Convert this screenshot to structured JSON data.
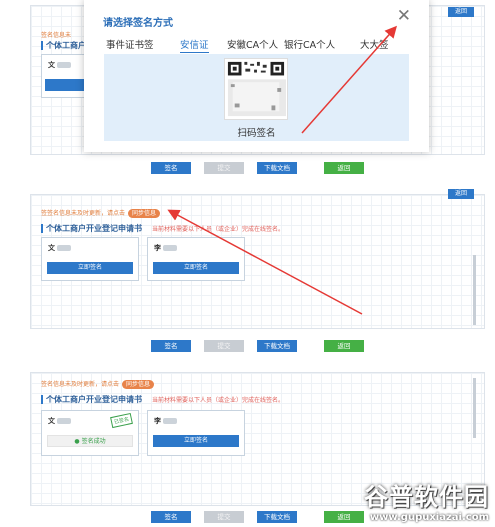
{
  "modal": {
    "title": "请选择签名方式",
    "close_glyph": "✕",
    "tabs": [
      "事件证书签",
      "安信证",
      "安徽CA个人",
      "银行CA个人",
      "大大签"
    ],
    "active_tab": 1,
    "qr_label": "扫码签名"
  },
  "sections": [
    {
      "notice": "签签名信息未及时更新，请点击",
      "sync_label": "同步信息",
      "title": "个体工商户开业登记申请书",
      "hint": "当前材料需要以下人员（或企业）完成在线签名。",
      "cards": [
        {
          "name": "文",
          "action": "立即签名",
          "done": false
        },
        {
          "name": "李",
          "action": "立即签名",
          "done": false
        }
      ]
    },
    {
      "notice": "签名信息未及时更新，请点击",
      "sync_label": "同步信息",
      "title": "个体工商户开业登记申请书",
      "hint": "当前材料需要以下人员（或企业）完成在线签名。",
      "cards": [
        {
          "name": "文",
          "action": "签名成功",
          "done": true,
          "stamp": "已签名"
        },
        {
          "name": "李",
          "action": "立即签名",
          "done": false
        }
      ]
    }
  ],
  "buttons": {
    "sign": "签名",
    "submit": "提交",
    "download": "下载文档",
    "back": "返回"
  },
  "corner_label": "返回",
  "watermark": {
    "brand": "谷普软件园",
    "url": "www.gupuxiazai.com"
  },
  "colors": {
    "primary": "#2d78c9",
    "success": "#45b045",
    "warning": "#e8834a",
    "arrow": "#e53935"
  }
}
